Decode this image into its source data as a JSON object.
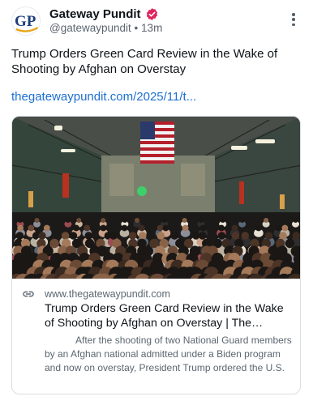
{
  "post": {
    "display_name": "Gateway Pundit",
    "handle": "@gatewaypundit",
    "separator": "•",
    "time": "13m",
    "avatar_text": "GP",
    "text": "Trump Orders Green Card Review in the Wake of Shooting by Afghan on Overstay",
    "link": "thegatewaypundit.com/2025/11/t..."
  },
  "card": {
    "domain": "www.thegatewaypundit.com",
    "title": "Trump Orders Green Card Review in the Wake of Shooting by Afghan on Overstay | The Gatewa...",
    "description": "After the shooting of two National Guard members by an Afghan national admitted under a Biden program and now on overstay, President Trump ordered the U.S."
  },
  "colors": {
    "accent": "#1d6fd1",
    "verified_badge": "#e0245e",
    "avatar_blue": "#1f3d7a",
    "avatar_gold": "#e8a317"
  },
  "icons": {
    "verified": "verified-badge-icon",
    "more": "more-options-icon",
    "link": "link-icon"
  }
}
